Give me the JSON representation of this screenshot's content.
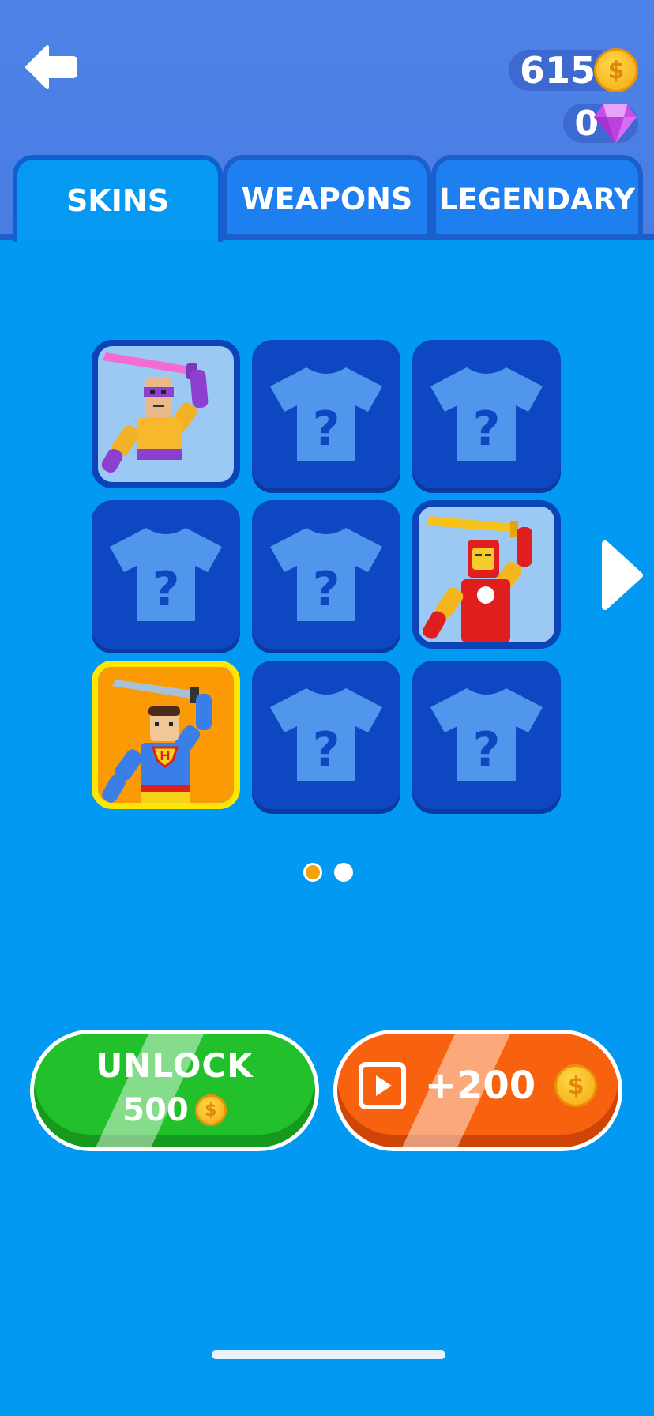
{
  "currency": {
    "coins": "615",
    "gems": "0",
    "coin_symbol": "$"
  },
  "tabs": [
    {
      "label": "SKINS",
      "active": true
    },
    {
      "label": "WEAPONS",
      "active": false
    },
    {
      "label": "LEGENDARY",
      "active": false
    }
  ],
  "grid": {
    "cells": [
      {
        "state": "unlocked",
        "character": "purple-masked-fighter"
      },
      {
        "state": "locked",
        "symbol": "?"
      },
      {
        "state": "locked",
        "symbol": "?"
      },
      {
        "state": "locked",
        "symbol": "?"
      },
      {
        "state": "locked",
        "symbol": "?"
      },
      {
        "state": "unlocked",
        "character": "red-armored-hero"
      },
      {
        "state": "selected",
        "character": "caped-hero",
        "chest_letter": "H"
      },
      {
        "state": "locked",
        "symbol": "?"
      },
      {
        "state": "locked",
        "symbol": "?"
      }
    ]
  },
  "pagination": {
    "pages": 2,
    "current": 1
  },
  "buttons": {
    "unlock": {
      "label": "UNLOCK",
      "price": "500"
    },
    "reward": {
      "amount": "+200"
    }
  },
  "colors": {
    "background": "#0299f3",
    "header": "#4e82e6",
    "locked_cell": "#0d48c2",
    "selected_border": "#ffe600",
    "unlock_button": "#22c12c",
    "reward_button": "#f8620e"
  }
}
